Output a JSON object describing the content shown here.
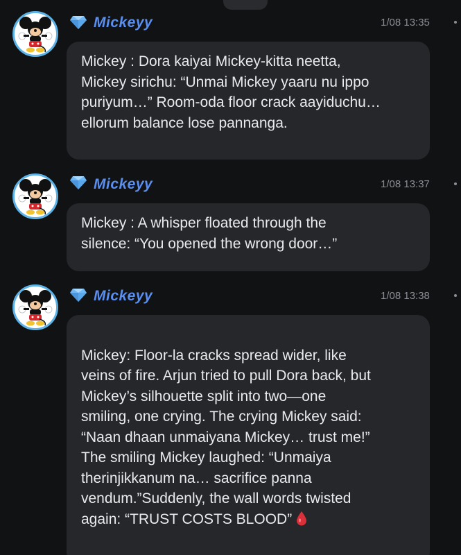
{
  "messages": [
    {
      "username": "Mickeyy",
      "time": "1/08 13:35",
      "text": "Mickey : Dora kaiyai Mickey-kitta neetta,\nMickey sirichu: “Unmai Mickey yaaru nu ippo\npuriyum…” Room-oda floor crack aayiduchu…\nellorum balance lose pannanga."
    },
    {
      "username": "Mickeyy",
      "time": "1/08 13:37",
      "text": "Mickey : A whisper floated through the\nsilence: “You opened the wrong door…”"
    },
    {
      "username": "Mickeyy",
      "time": "1/08 13:38",
      "text": "Mickey: Floor-la cracks spread wider, like\nveins of fire. Arjun tried to pull Dora back, but\nMickey’s silhouette split into two—one\nsmiling, one crying. The crying Mickey said:\n“Naan dhaan unmaiyana Mickey… trust me!”\nThe smiling Mickey laughed: “Unmaiya\ntherinjikkanum na… sacrifice panna\nvendum.”Suddenly, the wall words twisted\nagain: “TRUST COSTS BLOOD”",
      "trailing_icon": "blood-drop-icon"
    }
  ],
  "colors": {
    "background": "#111214",
    "bubble": "#26272b",
    "username": "#5a8ff0",
    "timestamp": "#8a8d93",
    "avatar_ring": "#5bb2e6",
    "drop": "#d9303a"
  },
  "icons": {
    "badge": "diamond-icon",
    "avatar": "mickey-avatar",
    "menu": "more-dots-icon"
  }
}
